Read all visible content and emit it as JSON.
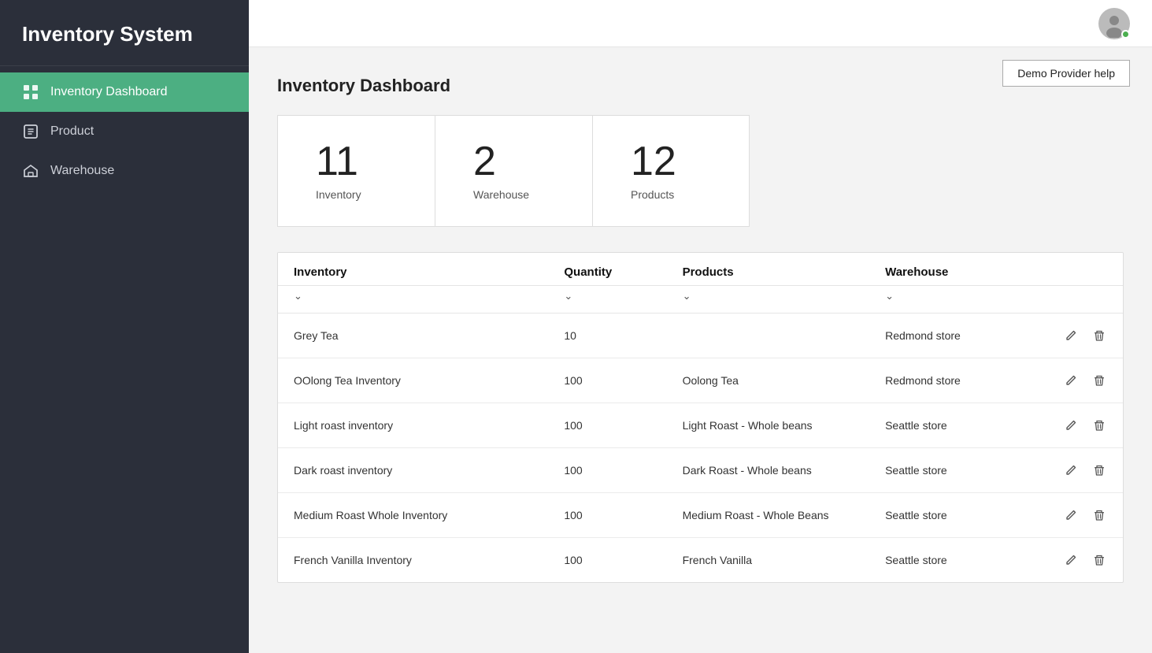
{
  "app": {
    "title": "Inventory System"
  },
  "sidebar": {
    "items": [
      {
        "id": "inventory-dashboard",
        "label": "Inventory Dashboard",
        "active": true
      },
      {
        "id": "product",
        "label": "Product",
        "active": false
      },
      {
        "id": "warehouse",
        "label": "Warehouse",
        "active": false
      }
    ]
  },
  "header": {
    "help_button": "Demo Provider help"
  },
  "page": {
    "title": "Inventory Dashboard"
  },
  "stats": [
    {
      "number": "11",
      "label": "Inventory"
    },
    {
      "number": "2",
      "label": "Warehouse"
    },
    {
      "number": "12",
      "label": "Products"
    }
  ],
  "table": {
    "columns": [
      "Inventory",
      "Quantity",
      "Products",
      "Warehouse"
    ],
    "rows": [
      {
        "inventory": "Grey Tea",
        "quantity": "10",
        "products": "",
        "warehouse": "Redmond store"
      },
      {
        "inventory": "OOlong Tea Inventory",
        "quantity": "100",
        "products": "Oolong Tea",
        "warehouse": "Redmond store"
      },
      {
        "inventory": "Light roast inventory",
        "quantity": "100",
        "products": "Light Roast - Whole beans",
        "warehouse": "Seattle store"
      },
      {
        "inventory": "Dark roast inventory",
        "quantity": "100",
        "products": "Dark Roast - Whole beans",
        "warehouse": "Seattle store"
      },
      {
        "inventory": "Medium Roast Whole Inventory",
        "quantity": "100",
        "products": "Medium Roast - Whole Beans",
        "warehouse": "Seattle store"
      },
      {
        "inventory": "French Vanilla Inventory",
        "quantity": "100",
        "products": "French Vanilla",
        "warehouse": "Seattle store"
      }
    ]
  }
}
